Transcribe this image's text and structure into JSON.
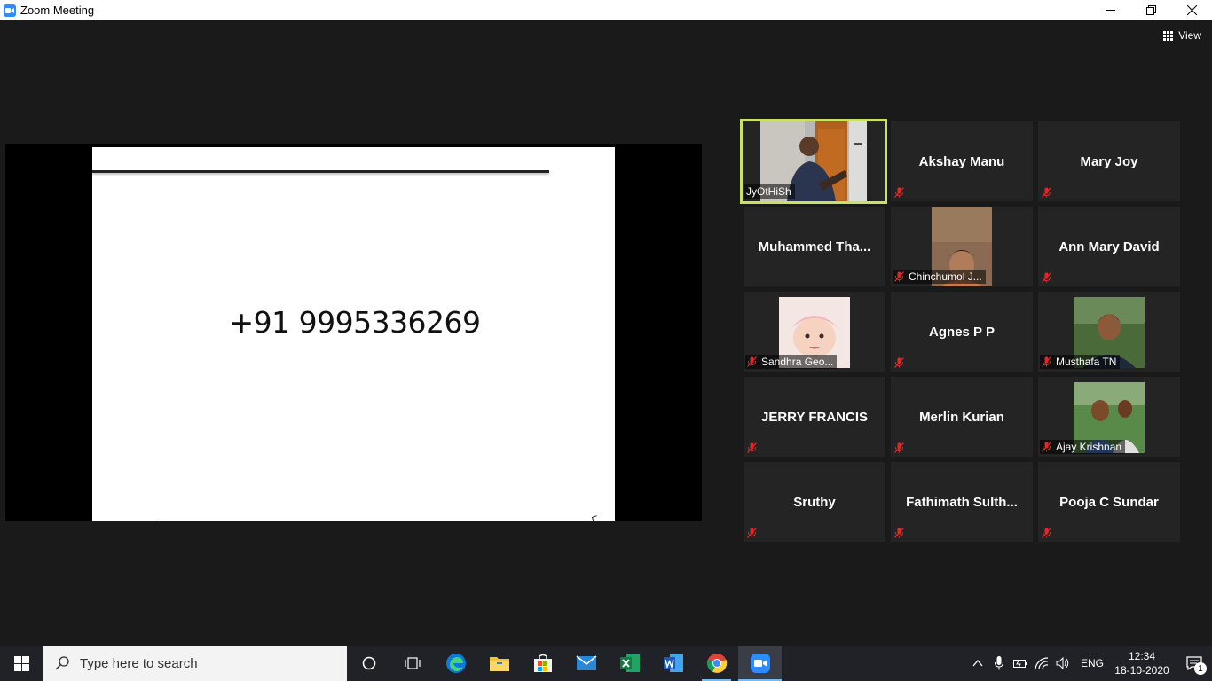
{
  "window": {
    "title": "Zoom Meeting"
  },
  "meeting": {
    "view_label": "View",
    "shared_slide_text": "+91 9995336269"
  },
  "participants": [
    {
      "name": "JyOtHiSh",
      "type": "video",
      "muted": false,
      "active_speaker": true
    },
    {
      "name": "Akshay Manu",
      "type": "name",
      "muted": true
    },
    {
      "name": "Mary Joy",
      "type": "name",
      "muted": true
    },
    {
      "name": "Muhammed  Tha...",
      "type": "name",
      "muted": false
    },
    {
      "name": "Chinchumol J...",
      "type": "photo",
      "muted": true
    },
    {
      "name": "Ann Mary David",
      "type": "name",
      "muted": true
    },
    {
      "name": "Sandhra Geo...",
      "type": "photo",
      "muted": true
    },
    {
      "name": "Agnes P P",
      "type": "name",
      "muted": true
    },
    {
      "name": "Musthafa TN",
      "type": "photo",
      "muted": true
    },
    {
      "name": "JERRY FRANCIS",
      "type": "name",
      "muted": true
    },
    {
      "name": "Merlin Kurian",
      "type": "name",
      "muted": true
    },
    {
      "name": "Ajay Krishnan",
      "type": "photo",
      "muted": true
    },
    {
      "name": "Sruthy",
      "type": "name",
      "muted": true
    },
    {
      "name": "Fathimath  Sulth...",
      "type": "name",
      "muted": true
    },
    {
      "name": "Pooja C Sundar",
      "type": "name",
      "muted": true
    }
  ],
  "taskbar": {
    "search_placeholder": "Type here to search",
    "apps": [
      "cortana",
      "task-view",
      "edge",
      "file-explorer",
      "store",
      "mail",
      "excel",
      "word",
      "chrome",
      "zoom"
    ],
    "language": "ENG",
    "time": "12:34",
    "date": "18-10-2020",
    "notification_count": "1"
  },
  "colors": {
    "active_speaker_border": "#c9e265",
    "mute_icon": "#e02828",
    "zoom_blue": "#2d8cff",
    "taskbar": "#202227"
  }
}
